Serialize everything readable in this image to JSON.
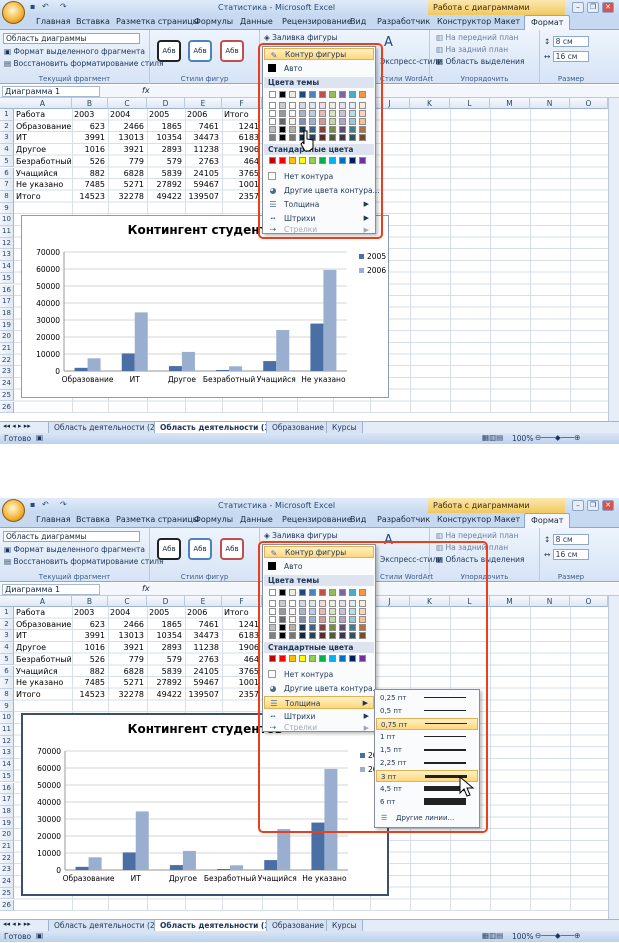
{
  "window": {
    "title": "Статистика - Microsoft Excel",
    "context_group": "Работа с диаграммами"
  },
  "ribbon_tabs": [
    "Главная",
    "Вставка",
    "Разметка страницы",
    "Формулы",
    "Данные",
    "Рецензирование",
    "Вид",
    "Разработчик",
    "Конструктор",
    "Макет",
    "Формат"
  ],
  "ribbon": {
    "current_fragment": {
      "selector_value": "Область диаграммы",
      "format_selection": "Формат выделенного фрагмента",
      "reset_style": "Восстановить форматирование стиля",
      "group_label": "Текущий фрагмент"
    },
    "shape_styles": {
      "style_label": "Абв",
      "group_label": "Стили фигур",
      "fill_button": "Заливка фигуры",
      "outline_button": "Контур фигуры",
      "effects_button": "Эффекты фигур"
    },
    "wordart": {
      "express_styles": "Экспресс-стили",
      "group_label": "Стили WordArt"
    },
    "arrange": {
      "bring_forward": "На передний план",
      "send_backward": "На задний план",
      "selection_pane": "Область выделения",
      "group_label": "Упорядочить"
    },
    "size": {
      "height": "8 см",
      "width": "16 см",
      "group_label": "Размер"
    }
  },
  "name_box": "Диаграмма 1",
  "fx": "fx",
  "columns": [
    "A",
    "B",
    "C",
    "D",
    "E",
    "F",
    "G",
    "H",
    "I",
    "J",
    "K",
    "L",
    "M",
    "N",
    "O"
  ],
  "row_numbers": [
    "1",
    "2",
    "3",
    "4",
    "5",
    "6",
    "7",
    "8",
    "9",
    "10",
    "11",
    "12",
    "13",
    "14",
    "15",
    "16",
    "17",
    "18",
    "19",
    "20",
    "21",
    "22",
    "23",
    "24",
    "25",
    "26"
  ],
  "table": {
    "rows": [
      [
        "Работа",
        "2003",
        "2004",
        "2005",
        "2006",
        "Итого"
      ],
      [
        "Образование",
        "623",
        "2466",
        "1865",
        "7461",
        "1241"
      ],
      [
        "ИТ",
        "3991",
        "13013",
        "10354",
        "34473",
        "6183"
      ],
      [
        "Другое",
        "1016",
        "3921",
        "2893",
        "11238",
        "1906"
      ],
      [
        "Безработный",
        "526",
        "779",
        "579",
        "2763",
        "464"
      ],
      [
        "Учащийся",
        "882",
        "6828",
        "5839",
        "24105",
        "3765"
      ],
      [
        "Не указано",
        "7485",
        "5271",
        "27892",
        "59467",
        "1001"
      ],
      [
        "Итого",
        "14523",
        "32278",
        "49422",
        "139507",
        "2357"
      ]
    ]
  },
  "chart_data": {
    "type": "bar",
    "title": "Контингент студентов",
    "categories": [
      "Образование",
      "ИТ",
      "Другое",
      "Безработный",
      "Учащийся",
      "Не указано"
    ],
    "series": [
      {
        "name": "2005",
        "values": [
          1865,
          10354,
          2893,
          579,
          5839,
          27892
        ],
        "color": "#4a6fa5"
      },
      {
        "name": "2006",
        "values": [
          7461,
          34473,
          11238,
          2763,
          24105,
          59467
        ],
        "color": "#9aaed0"
      }
    ],
    "ylim": [
      0,
      70000
    ],
    "yticks": [
      "0",
      "10000",
      "20000",
      "30000",
      "40000",
      "50000",
      "60000",
      "70000"
    ],
    "legend": "right",
    "grid": true
  },
  "outline_menu": {
    "auto": "Авто",
    "theme_colors": "Цвета темы",
    "standard_colors": "Стандартные цвета",
    "no_outline": "Нет контура",
    "more_colors": "Другие цвета контура...",
    "weight": "Толщина",
    "dashes": "Штрихи",
    "arrows": "Стрелки",
    "theme_palette": [
      "#ffffff",
      "#000000",
      "#eeece1",
      "#1f497d",
      "#4f81bd",
      "#c0504d",
      "#9bbb59",
      "#8064a2",
      "#4bacc6",
      "#f79646"
    ],
    "standard_palette": [
      "#c00000",
      "#ff0000",
      "#ffc000",
      "#ffff00",
      "#92d050",
      "#00b050",
      "#00b0f0",
      "#0070c0",
      "#002060",
      "#7030a0"
    ]
  },
  "weight_menu": {
    "items": [
      "0,25 пт",
      "0,5 пт",
      "0,75 пт",
      "1 пт",
      "1,5 пт",
      "2,25 пт",
      "3 пт",
      "4,5 пт",
      "6 пт"
    ],
    "more_lines": "Другие линии..."
  },
  "sheet_tabs": [
    "Область деятельности (2)",
    "Область деятельности (3)",
    "Образование",
    "Курсы"
  ],
  "status": {
    "ready": "Готово",
    "zoom": "100%"
  }
}
